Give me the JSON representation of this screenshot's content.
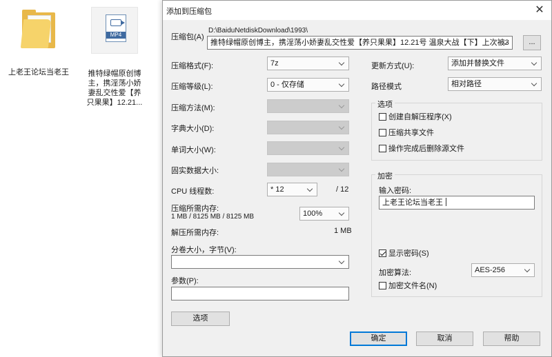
{
  "desktop": {
    "folder_label": "上老王论坛当老王",
    "file_label": "推特绿帽原创博主，携淫荡小娇妻乱交性爱【养只果果】12.21...",
    "file_tag": "MP4"
  },
  "dialog": {
    "title": "添加到压缩包",
    "close_glyph": "✕",
    "archive": {
      "label": "压缩包(A)",
      "path": "D:\\BaiduNetdiskDownload\\1993\\",
      "name": "推特绿帽原创博主，携淫荡小娇妻乱交性爱【养只果果】12.21号 温泉大战【下】上次被3",
      "browse_label": "..."
    },
    "format": {
      "label": "压缩格式(F):",
      "value": "7z"
    },
    "level": {
      "label": "压缩等级(L):",
      "value": "0 - 仅存储"
    },
    "method": {
      "label": "压缩方法(M):",
      "value": ""
    },
    "dict": {
      "label": "字典大小(D):",
      "value": ""
    },
    "word": {
      "label": "单词大小(W):",
      "value": ""
    },
    "solid": {
      "label": "固实数据大小:",
      "value": ""
    },
    "threads": {
      "label": "CPU 线程数:",
      "value": "* 12",
      "max": "/ 12"
    },
    "mem_compress": {
      "label": "压缩所需内存:",
      "detail": "1 MB / 8125 MB / 8125 MB",
      "percent": "100%"
    },
    "mem_decompress": {
      "label": "解压所需内存:",
      "value": "1 MB"
    },
    "split": {
      "label": "分卷大小，字节(V):",
      "value": ""
    },
    "params": {
      "label": "参数(P):",
      "value": ""
    },
    "options_button": "选项",
    "update_mode": {
      "label": "更新方式(U):",
      "value": "添加并替换文件"
    },
    "path_mode": {
      "label": "路径模式",
      "value": "相对路径"
    },
    "options_group": {
      "title": "选项",
      "sfx": "创建自解压程序(X)",
      "shared": "压缩共享文件",
      "delete": "操作完成后删除源文件"
    },
    "encryption": {
      "title": "加密",
      "password_label": "输入密码:",
      "password_value": "上老王论坛当老王",
      "show_password": "显示密码(S)",
      "method_label": "加密算法:",
      "method_value": "AES-256",
      "encrypt_names": "加密文件名(N)"
    },
    "ok": "确定",
    "cancel": "取消",
    "help": "帮助"
  }
}
